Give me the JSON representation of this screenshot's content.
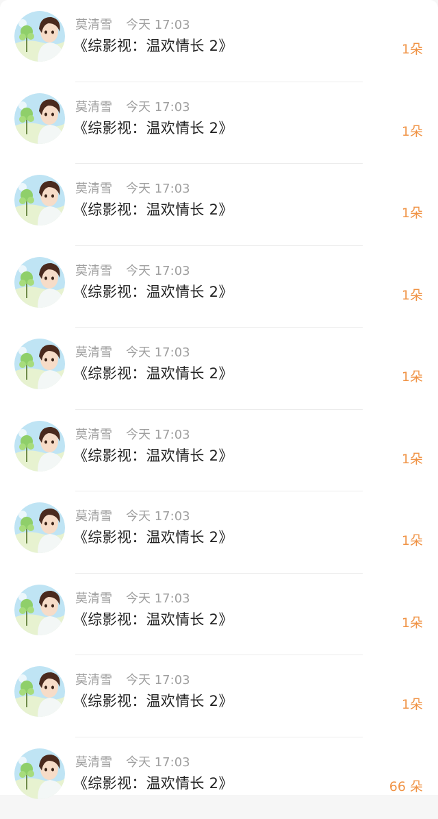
{
  "colors": {
    "name": "#9f9f9f",
    "title": "#222222",
    "count": "#f09345"
  },
  "items": [
    {
      "user": "莫清雪",
      "time": "今天 17:03",
      "title": "《综影视：温欢情长 2》",
      "count": "1朵",
      "avatar_icon": "user-avatar-icon"
    },
    {
      "user": "莫清雪",
      "time": "今天 17:03",
      "title": "《综影视：温欢情长 2》",
      "count": "1朵",
      "avatar_icon": "user-avatar-icon"
    },
    {
      "user": "莫清雪",
      "time": "今天 17:03",
      "title": "《综影视：温欢情长 2》",
      "count": "1朵",
      "avatar_icon": "user-avatar-icon"
    },
    {
      "user": "莫清雪",
      "time": "今天 17:03",
      "title": "《综影视：温欢情长 2》",
      "count": "1朵",
      "avatar_icon": "user-avatar-icon"
    },
    {
      "user": "莫清雪",
      "time": "今天 17:03",
      "title": "《综影视：温欢情长 2》",
      "count": "1朵",
      "avatar_icon": "user-avatar-icon"
    },
    {
      "user": "莫清雪",
      "time": "今天 17:03",
      "title": "《综影视：温欢情长 2》",
      "count": "1朵",
      "avatar_icon": "user-avatar-icon"
    },
    {
      "user": "莫清雪",
      "time": "今天 17:03",
      "title": "《综影视：温欢情长 2》",
      "count": "1朵",
      "avatar_icon": "user-avatar-icon"
    },
    {
      "user": "莫清雪",
      "time": "今天 17:03",
      "title": "《综影视：温欢情长 2》",
      "count": "1朵",
      "avatar_icon": "user-avatar-icon"
    },
    {
      "user": "莫清雪",
      "time": "今天 17:03",
      "title": "《综影视：温欢情长 2》",
      "count": "1朵",
      "avatar_icon": "user-avatar-icon"
    },
    {
      "user": "莫清雪",
      "time": "今天 17:03",
      "title": "《综影视：温欢情长 2》",
      "count": "66 朵",
      "avatar_icon": "user-avatar-icon"
    }
  ]
}
